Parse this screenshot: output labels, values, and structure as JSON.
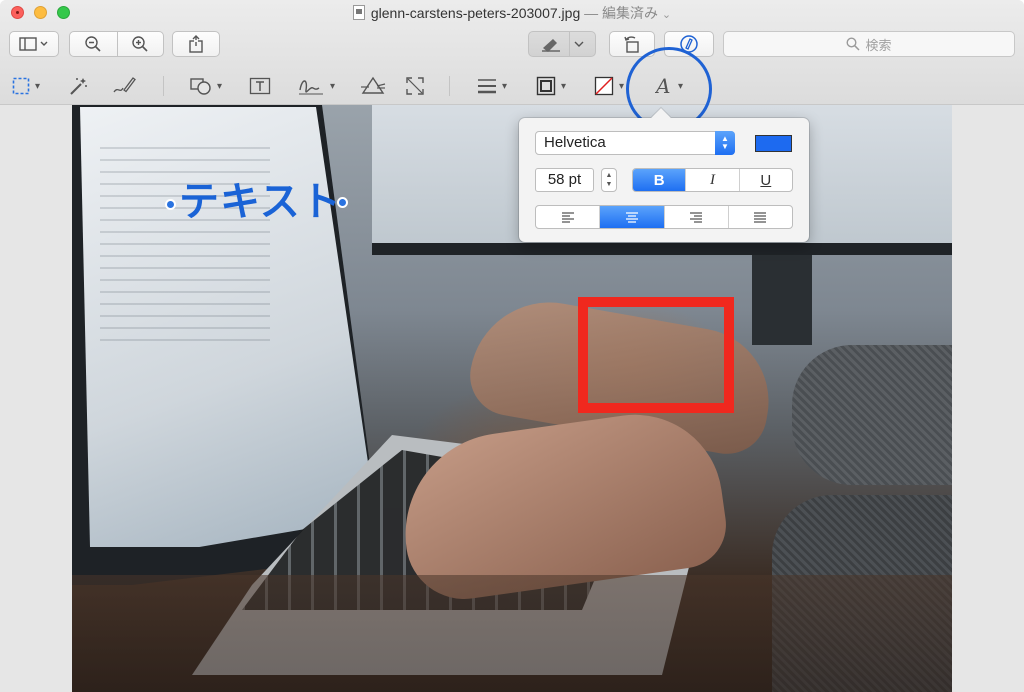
{
  "window": {
    "filename": "glenn-carstens-peters-203007.jpg",
    "status": "— 編集済み",
    "title_chevron": "⌄"
  },
  "toolbar": {
    "search_placeholder": "検索"
  },
  "canvas": {
    "annotation_text": "テキスト"
  },
  "font_popover": {
    "font_name": "Helvetica",
    "font_size": "58 pt",
    "bold_label": "B",
    "italic_label": "I",
    "underline_label": "U",
    "text_color": "#1d6af0",
    "selected_alignment": "center"
  },
  "colors": {
    "accent": "#1e6ff2",
    "annotation_text": "#1a63d6",
    "rectangle_stroke": "#f0281e",
    "highlight_circle": "#1f62d4"
  }
}
